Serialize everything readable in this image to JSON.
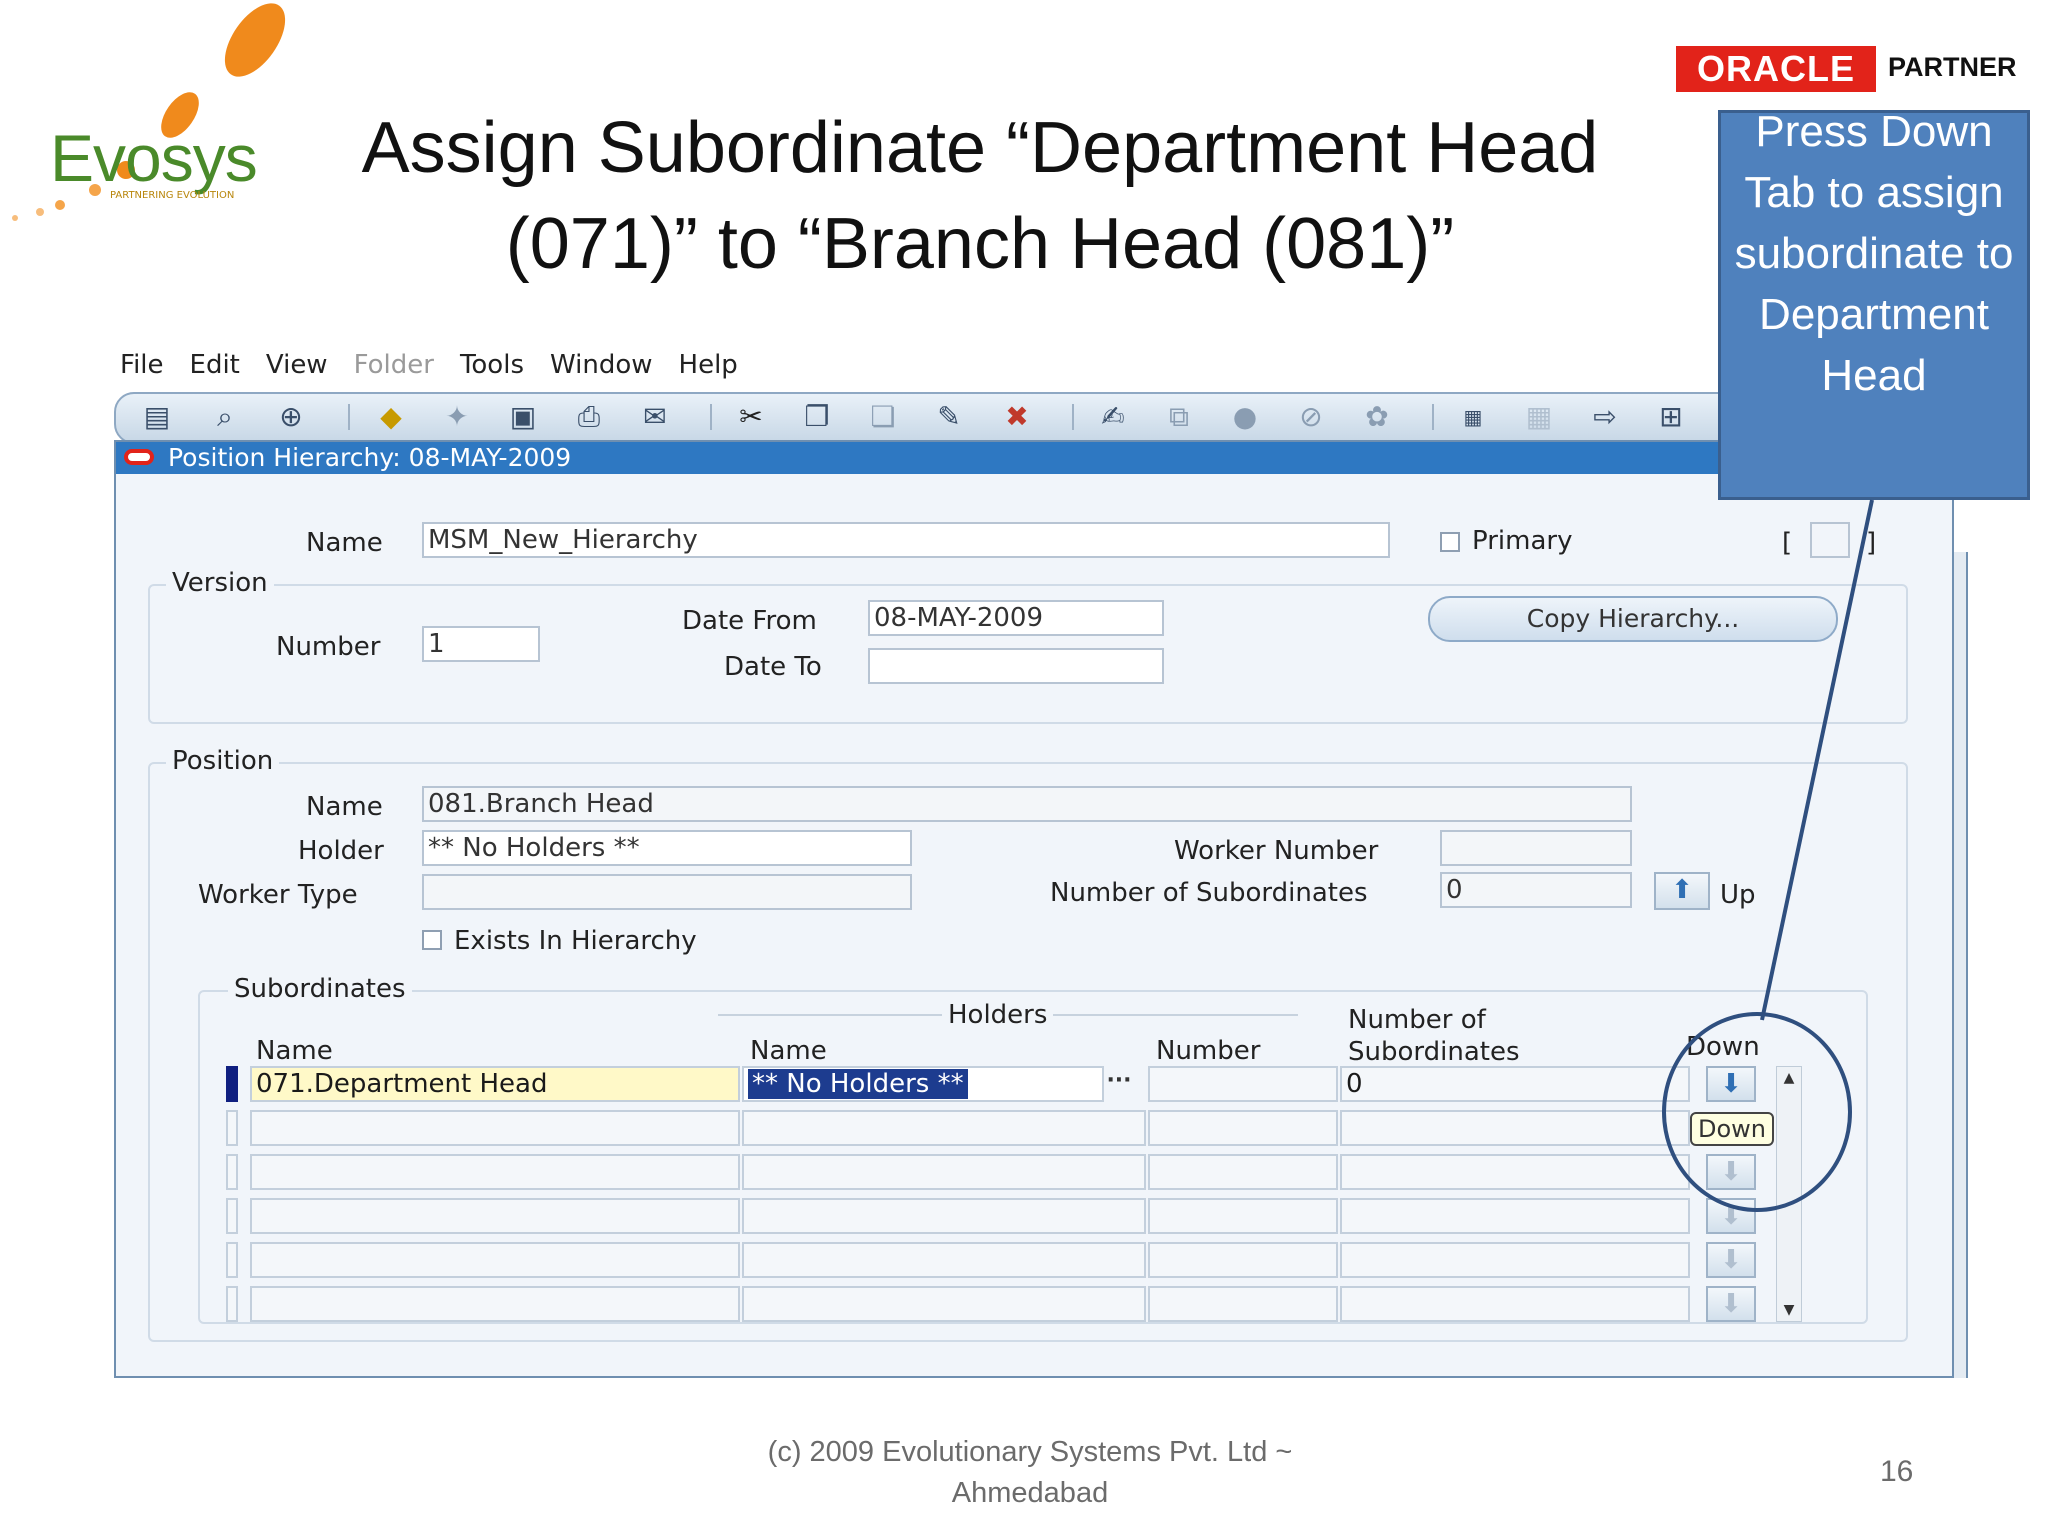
{
  "slide": {
    "logo_text": "Evosys",
    "logo_tagline": "PARTNERING EVOLUTION",
    "title_line1": "Assign Subordinate “Department Head",
    "title_line2": "(071)” to “Branch Head (081)”",
    "oracle_logo": "ORACLE",
    "oracle_partner": "PARTNER",
    "callout_text": "Press Down Tab to assign subordinate to Department Head",
    "footer_line1": "(c) 2009 Evolutionary Systems Pvt. Ltd ~",
    "footer_line2": "Ahmedabad",
    "page_number": "16"
  },
  "menu": [
    {
      "label": "File",
      "enabled": true
    },
    {
      "label": "Edit",
      "enabled": true
    },
    {
      "label": "View",
      "enabled": true
    },
    {
      "label": "Folder",
      "enabled": false
    },
    {
      "label": "Tools",
      "enabled": true
    },
    {
      "label": "Window",
      "enabled": true
    },
    {
      "label": "Help",
      "enabled": true
    }
  ],
  "toolbar_icons": [
    "new-record-icon",
    "find-icon",
    "navigator-icon",
    "save-icon",
    "next-step-icon",
    "print-setup-icon",
    "print-icon",
    "close-form-icon",
    "cut-icon",
    "copy-icon",
    "paste-icon",
    "clear-record-icon",
    "delete-record-icon",
    "edit-field-icon",
    "zoom-icon",
    "translations-icon",
    "attachments-icon",
    "folder-tools-icon",
    "calendar-icon",
    "calendar-disabled-icon",
    "window-icon",
    "help-icon"
  ],
  "window": {
    "title": "Position Hierarchy: 08-MAY-2009",
    "name_label": "Name",
    "name_value": "MSM_New_Hierarchy",
    "primary_label": "Primary",
    "bracket_open": "[",
    "bracket_close": "]",
    "version": {
      "title": "Version",
      "number_label": "Number",
      "number_value": "1",
      "date_from_label": "Date From",
      "date_from_value": "08-MAY-2009",
      "date_to_label": "Date To",
      "date_to_value": "",
      "copy_button": "Copy Hierarchy..."
    },
    "position": {
      "title": "Position",
      "name_label": "Name",
      "name_value": "081.Branch Head",
      "holder_label": "Holder",
      "holder_value": "** No Holders **",
      "worker_type_label": "Worker Type",
      "worker_type_value": "",
      "worker_number_label": "Worker Number",
      "worker_number_value": "",
      "num_sub_label": "Number of Subordinates",
      "num_sub_value": "0",
      "up_label": "Up",
      "exists_label": "Exists In Hierarchy"
    },
    "subordinates": {
      "title": "Subordinates",
      "holders_group": "Holders",
      "col_name": "Name",
      "col_holder_name": "Name",
      "col_number": "Number",
      "col_num_sub_line1": "Number of",
      "col_num_sub_line2": "Subordinates",
      "col_down": "Down",
      "rows": [
        {
          "name": "071.Department Head",
          "holder": "** No Holders **",
          "number": "",
          "subs": "0"
        },
        {
          "name": "",
          "holder": "",
          "number": "",
          "subs": ""
        },
        {
          "name": "",
          "holder": "",
          "number": "",
          "subs": ""
        },
        {
          "name": "",
          "holder": "",
          "number": "",
          "subs": ""
        },
        {
          "name": "",
          "holder": "",
          "number": "",
          "subs": ""
        },
        {
          "name": "",
          "holder": "",
          "number": "",
          "subs": ""
        }
      ],
      "tooltip": "Down"
    }
  },
  "colors": {
    "title_bar": "#2e78c2",
    "callout": "#4f81bd",
    "oracle_red": "#e2231a",
    "current_field": "#fff9c8"
  }
}
